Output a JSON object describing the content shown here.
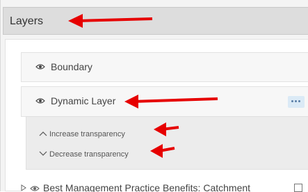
{
  "header": {
    "title": "Layers"
  },
  "layers": {
    "boundary": {
      "label": "Boundary",
      "icon": "eye-icon"
    },
    "dynamic": {
      "label": "Dynamic Layer",
      "icon": "eye-icon",
      "more_icon": "ellipsis-icon"
    },
    "bmp": {
      "label": "Best Management Practice Benefits: Catchment",
      "icon": "eye-icon"
    }
  },
  "transparency_menu": {
    "increase_label": "Increase transparency",
    "decrease_label": "Decrease transparency"
  },
  "annotations": {
    "arrow_color": "#e60000"
  }
}
